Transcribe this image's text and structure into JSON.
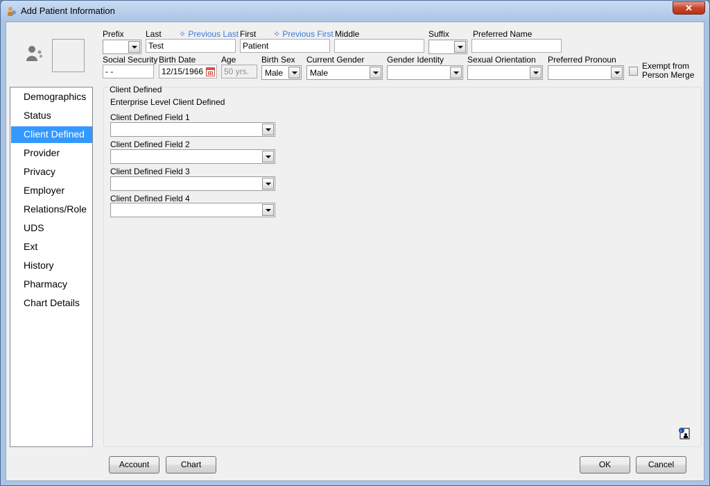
{
  "window": {
    "title": "Add Patient Information",
    "close_label": "✕"
  },
  "header": {
    "prefix_label": "Prefix",
    "last_label": "Last",
    "previous_last_label": "Previous Last",
    "last_value": "Test",
    "first_label": "First",
    "previous_first_label": "Previous First",
    "first_value": "Patient",
    "middle_label": "Middle",
    "middle_value": "",
    "suffix_label": "Suffix",
    "preferred_name_label": "Preferred Name",
    "preferred_name_value": "",
    "ssn_label": "Social Security",
    "ssn_value": "  -  -",
    "birth_date_label": "Birth Date",
    "birth_date_value": "12/15/1966",
    "age_label": "Age",
    "age_value": "50 yrs.",
    "birth_sex_label": "Birth Sex",
    "birth_sex_value": "Male",
    "current_gender_label": "Current Gender",
    "current_gender_value": "Male",
    "gender_identity_label": "Gender Identity",
    "gender_identity_value": "",
    "sexual_orientation_label": "Sexual Orientation",
    "sexual_orientation_value": "",
    "preferred_pronoun_label": "Preferred Pronoun",
    "preferred_pronoun_value": "",
    "exempt_line1": "Exempt from",
    "exempt_line2": "Person Merge"
  },
  "nav": {
    "items": [
      {
        "label": "Demographics"
      },
      {
        "label": "Status"
      },
      {
        "label": "Client Defined"
      },
      {
        "label": "Provider"
      },
      {
        "label": "Privacy"
      },
      {
        "label": "Employer"
      },
      {
        "label": "Relations/Role"
      },
      {
        "label": "UDS"
      },
      {
        "label": "Ext"
      },
      {
        "label": "History"
      },
      {
        "label": "Pharmacy"
      },
      {
        "label": "Chart Details"
      }
    ],
    "selected_index": 2
  },
  "client_defined": {
    "group_title": "Client Defined",
    "subtitle": "Enterprise Level Client Defined",
    "fields": [
      {
        "label": "Client Defined Field 1",
        "value": ""
      },
      {
        "label": "Client Defined Field 2",
        "value": ""
      },
      {
        "label": "Client Defined Field 3",
        "value": ""
      },
      {
        "label": "Client Defined Field 4",
        "value": ""
      }
    ]
  },
  "footer": {
    "account_label": "Account",
    "chart_label": "Chart",
    "ok_label": "OK",
    "cancel_label": "Cancel"
  },
  "colors": {
    "selection": "#3399ff",
    "link": "#3b7ad8"
  },
  "icons": [
    "patient-app-icon",
    "person-placeholder-icon",
    "calendar-icon",
    "help-info-icon",
    "sparkle-icon"
  ]
}
